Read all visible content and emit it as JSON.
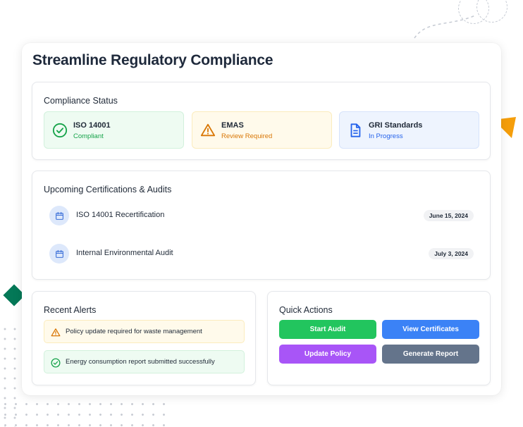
{
  "main": {
    "title": "Streamline Regulatory Compliance"
  },
  "compliance_status": {
    "title": "Compliance Status",
    "items": [
      {
        "name": "ISO 14001",
        "state": "Compliant",
        "icon": "check-circle-icon",
        "color": "#16a34a"
      },
      {
        "name": "EMAS",
        "state": "Review Required",
        "icon": "warning-triangle-icon",
        "color": "#d97706"
      },
      {
        "name": "GRI Standards",
        "state": "In Progress",
        "icon": "document-icon",
        "color": "#2563eb"
      }
    ]
  },
  "upcoming": {
    "title": "Upcoming Certifications & Audits",
    "items": [
      {
        "label": "ISO 14001 Recertification",
        "date": "June 15, 2024",
        "icon": "calendar-icon"
      },
      {
        "label": "Internal Environmental Audit",
        "date": "July 3, 2024",
        "icon": "calendar-icon"
      }
    ]
  },
  "alerts": {
    "title": "Recent Alerts",
    "items": [
      {
        "text": "Policy update required for waste management",
        "icon": "warning-triangle-icon",
        "color": "#d97706"
      },
      {
        "text": "Energy consumption report submitted successfully",
        "icon": "check-circle-icon",
        "color": "#16a34a"
      }
    ]
  },
  "quick_actions": {
    "title": "Quick Actions",
    "buttons": [
      {
        "label": "Start Audit",
        "color": "#22c55e"
      },
      {
        "label": "View Certificates",
        "color": "#3b82f6"
      },
      {
        "label": "Update Policy",
        "color": "#a855f7"
      },
      {
        "label": "Generate Report",
        "color": "#64748b"
      }
    ]
  }
}
